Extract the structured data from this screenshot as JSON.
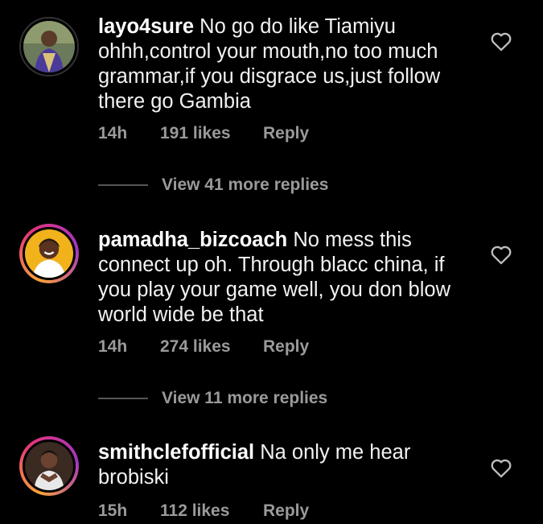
{
  "comments": [
    {
      "username": "layo4sure",
      "text": "No go do like Tiamiyu ohhh,control your mouth,no too much grammar,if you disgrace us,just follow there go Gambia",
      "time": "14h",
      "likes": "191 likes",
      "reply_label": "Reply",
      "view_replies": "View 41 more replies",
      "avatar_icon": "user-avatar-icon"
    },
    {
      "username": "pamadha_bizcoach",
      "text": "No mess this connect up oh. Through blacc china, if you play your game well, you don blow world wide be that",
      "time": "14h",
      "likes": "274 likes",
      "reply_label": "Reply",
      "view_replies": "View 11 more replies",
      "avatar_icon": "user-avatar-icon"
    },
    {
      "username": "smithclefofficial",
      "text": "Na only me hear brobiski",
      "time": "15h",
      "likes": "112 likes",
      "reply_label": "Reply",
      "avatar_icon": "user-avatar-icon"
    }
  ],
  "icons": {
    "like": "heart-outline-icon"
  },
  "colors": {
    "background": "#000000",
    "text": "#f2f2f2",
    "meta": "#9a9a9a",
    "story_ring": [
      "#f9a23a",
      "#e4357a",
      "#a334c2"
    ]
  }
}
